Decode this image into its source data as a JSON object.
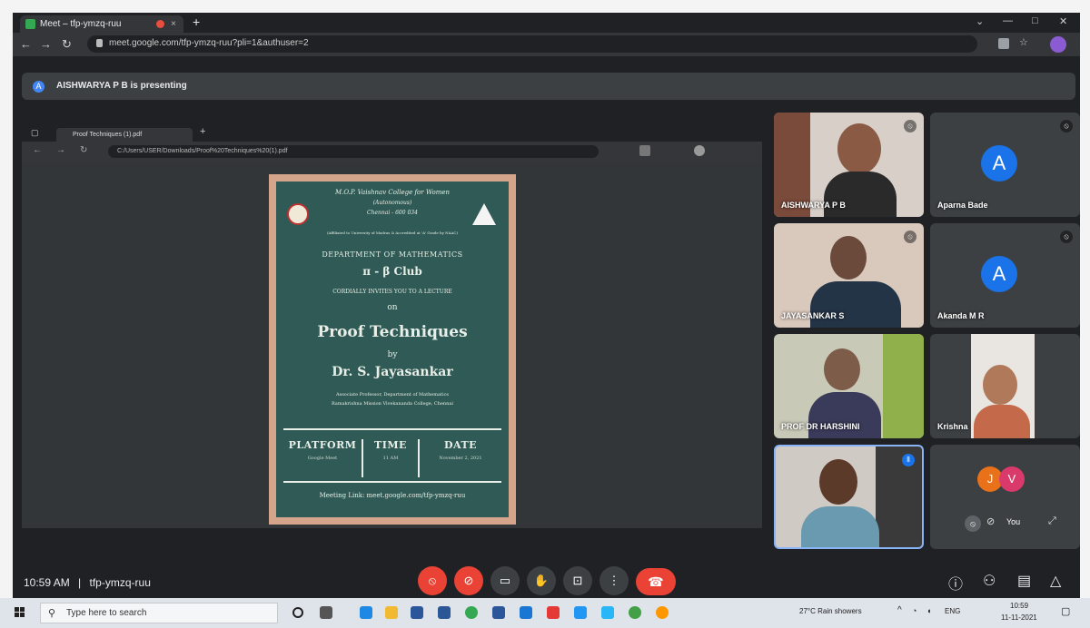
{
  "browser": {
    "tab_title": "Meet – tfp-ymzq-ruu",
    "url": "meet.google.com/tfp-ymzq-ruu?pli=1&authuser=2"
  },
  "meet": {
    "banner_text": "AISHWARYA P B is presenting",
    "banner_initial": "A",
    "clock": "10:59 AM",
    "separator": "|",
    "meeting_code": "tfp-ymzq-ruu"
  },
  "shared_screen": {
    "tab_title": "Proof Techniques (1).pdf",
    "url": "C:/Users/USER/Downloads/Proof%20Techniques%20(1).pdf"
  },
  "poster": {
    "college_line1": "M.O.P. Vaishnav College for Women",
    "college_line2": "(Autonomous)",
    "college_line3": "Chennai - 600 034",
    "affiliation": "(Affiliated to University of Madras & Accredited at 'A' Grade by NAAC)",
    "department": "DEPARTMENT OF MATHEMATICS",
    "club": "π - β Club",
    "organises": "CORDIALLY INVITES YOU TO A LECTURE",
    "on": "on",
    "topic": "Proof Techniques",
    "by": "by",
    "speaker": "Dr. S. Jayasankar",
    "speaker_desc1": "Associate Professor, Department of Mathematics",
    "speaker_desc2": "Ramakrishna Mission Vivekananda College, Chennai",
    "platform_label": "PLATFORM",
    "platform_value": "Google Meet",
    "time_label": "TIME",
    "time_value": "11 AM",
    "date_label": "DATE",
    "date_value": "November 2, 2021",
    "meeting_link": "Meeting Link: meet.google.com/tfp-ymzq-ruu"
  },
  "participants": [
    {
      "name": "AISHWARYA P B"
    },
    {
      "name": "Aparna Bade",
      "initial": "A"
    },
    {
      "name": "JAYASANKAR S"
    },
    {
      "name": "Akanda M R",
      "initial": "A"
    },
    {
      "name": "PROF DR HARSHINI"
    },
    {
      "name": "Krishna"
    },
    {
      "name": ""
    },
    {
      "name": "You",
      "initials": [
        "J",
        "V"
      ]
    }
  ],
  "taskbar": {
    "search_placeholder": "Type here to search",
    "weather": "27°C Rain showers",
    "language": "ENG",
    "time": "10:59",
    "date": "11-11-2021"
  },
  "colors": {
    "meet_bg": "#202124",
    "end_call": "#ea4335",
    "avatar_blue": "#1a73e8",
    "poster_board": "#2f5a55"
  }
}
